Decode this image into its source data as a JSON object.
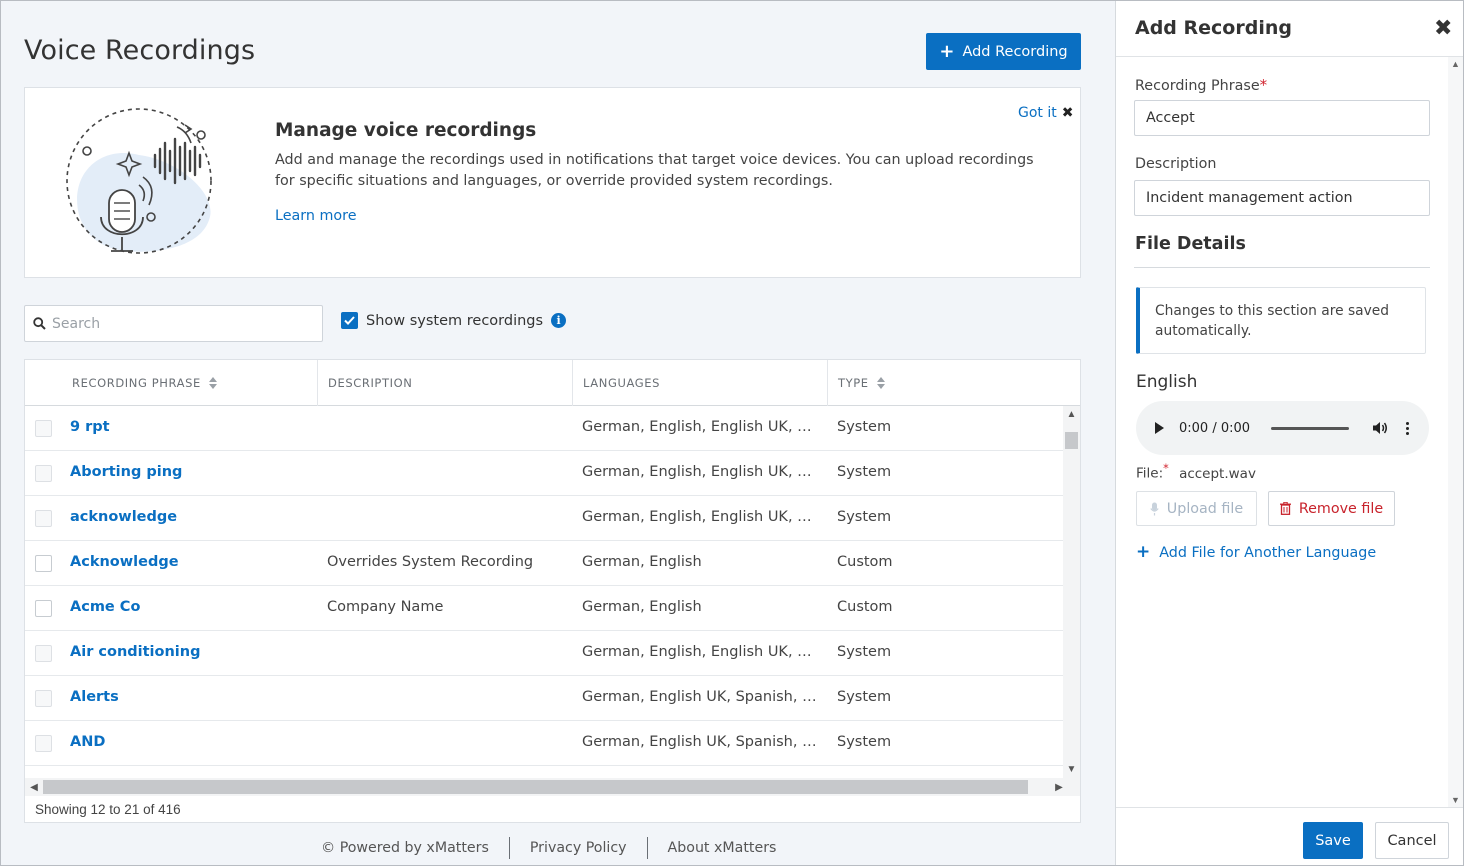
{
  "page": {
    "title": "Voice Recordings",
    "add_button_label": "Add Recording"
  },
  "banner": {
    "title": "Manage voice recordings",
    "body": "Add and manage the recordings used in notifications that target voice devices. You can upload recordings for specific situations and languages, or override provided system recordings.",
    "learn_more": "Learn more",
    "got_it": "Got it"
  },
  "search": {
    "placeholder": "Search",
    "value": ""
  },
  "filter": {
    "show_system_label": "Show system recordings",
    "show_system_checked": true
  },
  "table": {
    "columns": [
      "RECORDING PHRASE",
      "DESCRIPTION",
      "LANGUAGES",
      "TYPE"
    ],
    "rows": [
      {
        "phrase": "9 rpt",
        "description": "",
        "languages": "German, English, English UK, S...",
        "type": "System"
      },
      {
        "phrase": "Aborting ping",
        "description": "",
        "languages": "German, English, English UK, S...",
        "type": "System"
      },
      {
        "phrase": "acknowledge",
        "description": "",
        "languages": "German, English, English UK, S...",
        "type": "System"
      },
      {
        "phrase": "Acknowledge",
        "description": "Overrides System Recording",
        "languages": "German, English",
        "type": "Custom"
      },
      {
        "phrase": "Acme Co",
        "description": "Company Name",
        "languages": "German, English",
        "type": "Custom"
      },
      {
        "phrase": "Air conditioning",
        "description": "",
        "languages": "German, English, English UK, S...",
        "type": "System"
      },
      {
        "phrase": "Alerts",
        "description": "",
        "languages": "German, English UK, Spanish, F...",
        "type": "System"
      },
      {
        "phrase": "AND",
        "description": "",
        "languages": "German, English UK, Spanish, F...",
        "type": "System"
      }
    ],
    "showing": "Showing 12 to 21 of 416"
  },
  "footer": {
    "powered": "© Powered by xMatters",
    "privacy": "Privacy Policy",
    "about": "About xMatters"
  },
  "panel": {
    "title": "Add Recording",
    "phrase_label": "Recording Phrase",
    "phrase_value": "Accept",
    "description_label": "Description",
    "description_value": "Incident management action",
    "file_details_heading": "File Details",
    "note": "Changes to this section are saved automatically.",
    "language": "English",
    "audio_time": "0:00 / 0:00",
    "file_label": "File:",
    "file_name": "accept.wav",
    "upload_label": "Upload file",
    "remove_label": "Remove file",
    "add_language_label": "Add File for Another Language",
    "save_label": "Save",
    "cancel_label": "Cancel"
  },
  "colors": {
    "accent": "#0a6fc2",
    "danger": "#c8232c",
    "background": "#f2f5f9"
  }
}
